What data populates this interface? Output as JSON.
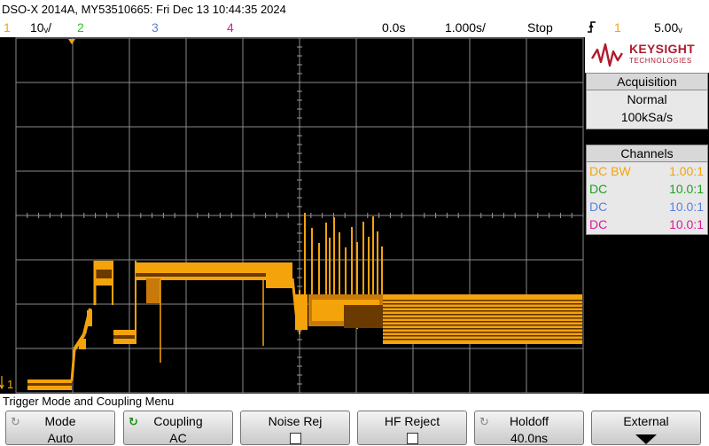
{
  "title_bar": {
    "text": "DSO-X 2014A, MY53510665: Fri Dec 13 10:44:35 2024"
  },
  "status_bar": {
    "ch1_num": "1",
    "ch1_scale": "10ᵥ/",
    "ch2_num": "2",
    "ch3_num": "3",
    "ch4_num": "4",
    "time_delay": "0.0s",
    "time_scale": "1.000s/",
    "run_state": "Stop",
    "trigger_icon": "rising-edge-trigger-icon",
    "trigger_channel": "1",
    "trigger_level": "5.00ᵥ"
  },
  "colors": {
    "ch1": "#f5a30a",
    "ch2": "#27c127",
    "ch3": "#5b7fe0",
    "ch4": "#e0179a",
    "grid": "#8a8a8a",
    "brand": "#b01c2e"
  },
  "brand": {
    "name": "KEYSIGHT",
    "sub": "TECHNOLOGIES"
  },
  "acquisition": {
    "heading": "Acquisition",
    "mode": "Normal",
    "rate": "100kSa/s"
  },
  "channels": {
    "heading": "Channels",
    "rows": [
      {
        "coupling": "DC BW",
        "probe": "1.00:1",
        "color": "#f5a30a"
      },
      {
        "coupling": "DC",
        "probe": "10.0:1",
        "color": "#27c127"
      },
      {
        "coupling": "DC",
        "probe": "10.0:1",
        "color": "#5b7fe0"
      },
      {
        "coupling": "DC",
        "probe": "10.0:1",
        "color": "#e0179a"
      }
    ]
  },
  "ground_marker": {
    "label": "1"
  },
  "menu": {
    "title": "Trigger Mode and Coupling Menu",
    "softkeys": [
      {
        "label": "Mode",
        "value": "Auto",
        "icon": "rotate-knob-icon"
      },
      {
        "label": "Coupling",
        "value": "AC",
        "icon": "rotate-knob-icon"
      },
      {
        "label": "Noise Rej",
        "value": "",
        "icon": "checkbox-icon"
      },
      {
        "label": "HF Reject",
        "value": "",
        "icon": "checkbox-icon"
      },
      {
        "label": "Holdoff",
        "value": "40.0ns",
        "icon": "rotate-knob-icon"
      },
      {
        "label": "External",
        "value": "",
        "icon": "down-arrow-icon"
      }
    ]
  }
}
